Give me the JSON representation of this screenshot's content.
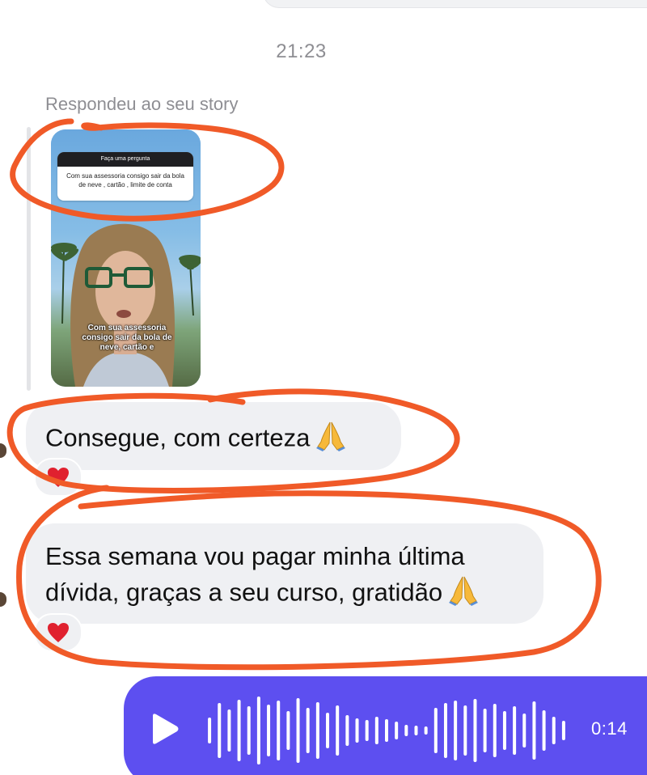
{
  "conversation": {
    "timestamp": "21:23",
    "reply_context": "Respondeu ao seu story"
  },
  "story_preview": {
    "question_header": "Faça uma pergunta",
    "question_text": "Com sua assessoria consigo sair da bola de neve , cartão , limite de conta",
    "caption": "Com sua assessoria consigo sair da bola de neve, cartão e"
  },
  "messages": [
    {
      "text": "Consegue, com certeza",
      "emoji_icon": "folded-hands-icon",
      "reaction": "heart-icon"
    },
    {
      "line1": "Essa semana vou pagar minha última",
      "line2": "dívida, graças a seu curso, gratidão",
      "emoji_icon": "folded-hands-icon",
      "reaction": "heart-icon"
    }
  ],
  "voice_message": {
    "duration": "0:14",
    "icon": "play-icon",
    "color": "#5d4ff0"
  },
  "colors": {
    "annotation": "#f05a28",
    "bubble": "#eff0f3",
    "heart": "#e0212f"
  }
}
